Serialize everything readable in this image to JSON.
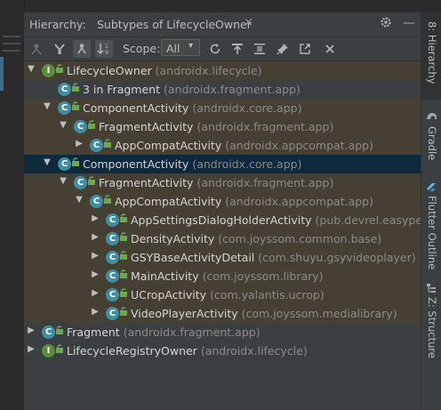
{
  "panel": {
    "title": "Hierarchy:",
    "tab_title": "Subtypes of LifecycleOwner",
    "tab_close": "×",
    "settings_icon": "gear-icon",
    "minimize_label": "—"
  },
  "toolbar": {
    "scope_label": "Scope:",
    "scope_value": "All",
    "scope_arrow": "▾"
  },
  "tree": [
    {
      "depth": 0,
      "arrow": "▼",
      "icon": "I",
      "icon_color": "green",
      "name": "LifecycleOwner",
      "pkg": "(androidx.lifecycle)",
      "state": "hl"
    },
    {
      "depth": 1,
      "arrow": "",
      "icon": "C",
      "icon_color": "blue",
      "name": "3 in Fragment",
      "pkg": "(androidx.fragment.app)",
      "state": ""
    },
    {
      "depth": 1,
      "arrow": "▼",
      "icon": "C",
      "icon_color": "blue",
      "name": "ComponentActivity",
      "pkg": "(androidx.core.app)",
      "state": "hl"
    },
    {
      "depth": 2,
      "arrow": "▼",
      "icon": "C",
      "icon_color": "blue",
      "name": "FragmentActivity",
      "pkg": "(androidx.fragment.app)",
      "state": "hl"
    },
    {
      "depth": 3,
      "arrow": "▶",
      "icon": "C",
      "icon_color": "blue",
      "name": "AppCompatActivity",
      "pkg": "(androidx.appcompat.app)",
      "state": "hl"
    },
    {
      "depth": 1,
      "arrow": "▼",
      "icon": "C",
      "icon_color": "blue",
      "name": "ComponentActivity",
      "pkg": "(androidx.core.app)",
      "state": "sel"
    },
    {
      "depth": 2,
      "arrow": "▼",
      "icon": "C",
      "icon_color": "blue",
      "name": "FragmentActivity",
      "pkg": "(androidx.fragment.app)",
      "state": "hl"
    },
    {
      "depth": 3,
      "arrow": "▼",
      "icon": "C",
      "icon_color": "blue",
      "name": "AppCompatActivity",
      "pkg": "(androidx.appcompat.app)",
      "state": "hl"
    },
    {
      "depth": 4,
      "arrow": "▶",
      "icon": "C",
      "icon_color": "blue",
      "name": "AppSettingsDialogHolderActivity",
      "pkg": "(pub.devrel.easypermi",
      "state": "hl"
    },
    {
      "depth": 4,
      "arrow": "▶",
      "icon": "C",
      "icon_color": "blue",
      "name": "DensityActivity",
      "pkg": "(com.joyssom.common.base)",
      "state": "hl"
    },
    {
      "depth": 4,
      "arrow": "▶",
      "icon": "C",
      "icon_color": "blue",
      "name": "GSYBaseActivityDetail",
      "pkg": "(com.shuyu.gsyvideoplayer)",
      "state": "hl"
    },
    {
      "depth": 4,
      "arrow": "▶",
      "icon": "C",
      "icon_color": "blue",
      "name": "MainActivity",
      "pkg": "(com.joyssom.library)",
      "state": "hl"
    },
    {
      "depth": 4,
      "arrow": "▶",
      "icon": "C",
      "icon_color": "blue",
      "name": "UCropActivity",
      "pkg": "(com.yalantis.ucrop)",
      "state": "hl"
    },
    {
      "depth": 4,
      "arrow": "▶",
      "icon": "C",
      "icon_color": "blue",
      "name": "VideoPlayerActivity",
      "pkg": "(com.joyssom.medialibrary)",
      "state": "hl"
    },
    {
      "depth": 0,
      "arrow": "▶",
      "icon": "C",
      "icon_color": "blue",
      "name": "Fragment",
      "pkg": "(androidx.fragment.app)",
      "state": ""
    },
    {
      "depth": 0,
      "arrow": "▶",
      "icon": "I",
      "icon_color": "green",
      "name": "LifecycleRegistryOwner",
      "pkg": "(androidx.lifecycle)",
      "state": ""
    }
  ],
  "right_tabs": {
    "hierarchy": "8: Hierarchy",
    "gradle": "Gradle",
    "flutter": "Flutter Outline",
    "structure": "Z: Structure"
  }
}
